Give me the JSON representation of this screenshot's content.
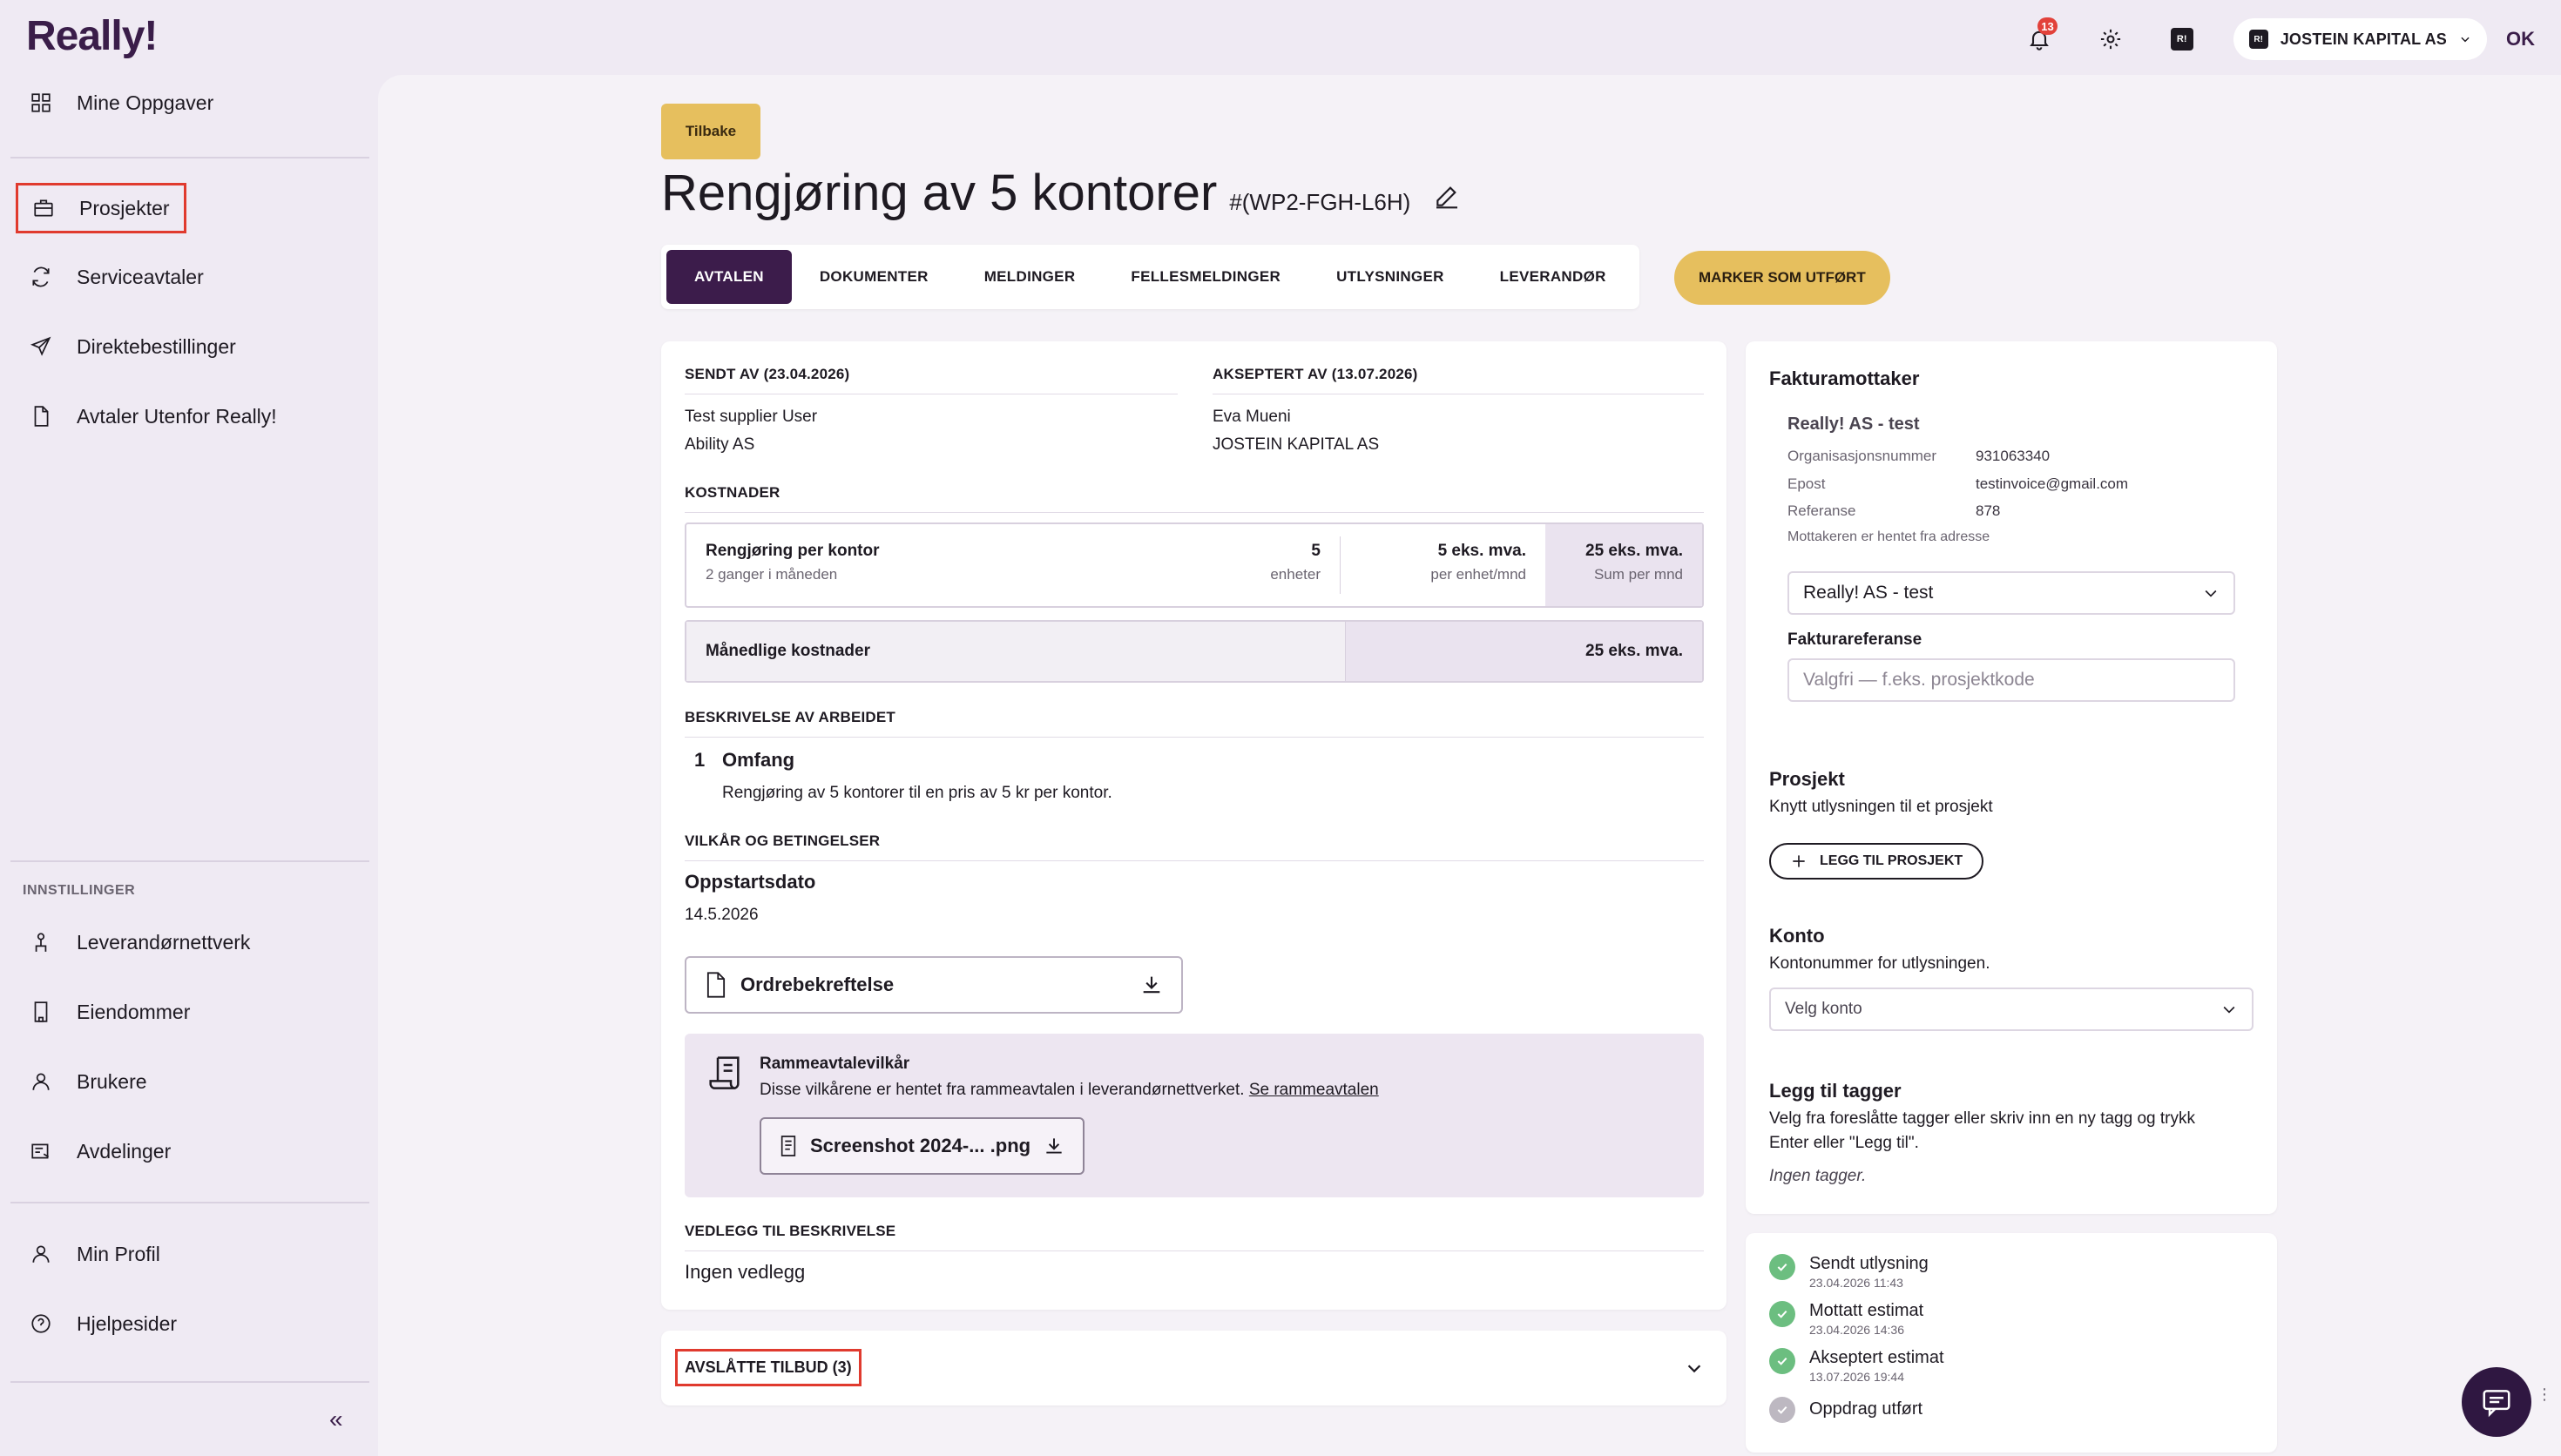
{
  "app": {
    "logo": "Really!"
  },
  "topbar": {
    "notifications_count": "13",
    "account_badge": "R!",
    "account_name": "JOSTEIN KAPITAL AS",
    "ok_label": "OK"
  },
  "sidebar": {
    "items": [
      {
        "label": "Mine Oppgaver",
        "icon": "grid-icon"
      },
      {
        "label": "Prosjekter",
        "icon": "briefcase-icon"
      },
      {
        "label": "Serviceavtaler",
        "icon": "refresh-icon"
      },
      {
        "label": "Direktebestillinger",
        "icon": "send-icon"
      },
      {
        "label": "Avtaler Utenfor Really!",
        "icon": "document-icon"
      }
    ],
    "settings_heading": "INNSTILLINGER",
    "settings_items": [
      {
        "label": "Leverandørnettverk",
        "icon": "network-icon"
      },
      {
        "label": "Eiendommer",
        "icon": "building-icon"
      },
      {
        "label": "Brukere",
        "icon": "user-icon"
      },
      {
        "label": "Avdelinger",
        "icon": "departments-icon"
      }
    ],
    "bottom_items": [
      {
        "label": "Min Profil",
        "icon": "user-icon"
      },
      {
        "label": "Hjelpesider",
        "icon": "help-icon"
      }
    ],
    "collapse_glyph": "«"
  },
  "page": {
    "back_label": "Tilbake",
    "title": "Rengjøring av 5 kontorer",
    "code": "#(WP2-FGH-L6H)",
    "tabs": [
      "AVTALEN",
      "DOKUMENTER",
      "MELDINGER",
      "FELLESMELDINGER",
      "UTLYSNINGER",
      "LEVERANDØR"
    ],
    "mark_done_label": "MARKER SOM UTFØRT"
  },
  "agreement": {
    "sent_label": "SENDT AV (23.04.2026)",
    "sent_name": "Test supplier User",
    "sent_company": "Ability AS",
    "accepted_label": "AKSEPTERT AV (13.07.2026)",
    "accepted_name": "Eva Mueni",
    "accepted_company": "JOSTEIN KAPITAL AS",
    "costs_label": "KOSTNADER",
    "cost_item": {
      "name": "Rengjøring per kontor",
      "frequency": "2 ganger i måneden",
      "qty": "5",
      "qty_unit": "enheter",
      "price": "5 eks. mva.",
      "price_unit": "per enhet/mnd",
      "sum": "25 eks. mva.",
      "sum_unit": "Sum per mnd"
    },
    "monthly_label": "Månedlige kostnader",
    "monthly_value": "25 eks. mva.",
    "description_label": "BESKRIVELSE AV ARBEIDET",
    "scope_number": "1",
    "scope_title": "Omfang",
    "scope_text": "Rengjøring av 5 kontorer til en pris av 5 kr per kontor.",
    "terms_label": "VILKÅR OG BETINGELSER",
    "start_label": "Oppstartsdato",
    "start_date": "14.5.2026",
    "order_confirmation": "Ordrebekreftelse",
    "frame_title": "Rammeavtalevilkår",
    "frame_desc": "Disse vilkårene er hentet fra rammeavtalen i leverandørnettverket.",
    "frame_link": "Se rammeavtalen",
    "frame_file": "Screenshot 2024-... .png",
    "attachments_label": "VEDLEGG TIL BESKRIVELSE",
    "attachments_value": "Ingen vedlegg",
    "rejected_label": "AVSLÅTTE TILBUD (3)"
  },
  "invoice": {
    "heading": "Fakturamottaker",
    "recipient_name": "Really! AS - test",
    "org_label": "Organisasjonsnummer",
    "org_value": "931063340",
    "email_label": "Epost",
    "email_value": "testinvoice@gmail.com",
    "ref_label": "Referanse",
    "ref_value": "878",
    "note": "Mottakeren er hentet fra adresse",
    "recipient_select": "Really! AS - test",
    "invoice_ref_label": "Fakturareferanse",
    "invoice_ref_placeholder": "Valgfri — f.eks. prosjektkode",
    "project_heading": "Prosjekt",
    "project_sub": "Knytt utlysningen til et prosjekt",
    "add_project_label": "LEGG TIL PROSJEKT",
    "account_heading": "Konto",
    "account_sub": "Kontonummer for utlysningen.",
    "account_select": "Velg konto",
    "tags_heading": "Legg til tagger",
    "tags_sub_1": "Velg fra foreslåtte tagger eller skriv inn en ny tagg og trykk",
    "tags_sub_2": "Enter eller \"Legg til\".",
    "tags_empty": "Ingen tagger."
  },
  "timeline": [
    {
      "title": "Sendt utlysning",
      "date": "23.04.2026 11:43",
      "done": true
    },
    {
      "title": "Mottatt estimat",
      "date": "23.04.2026 14:36",
      "done": true
    },
    {
      "title": "Akseptert estimat",
      "date": "13.07.2026 19:44",
      "done": true
    },
    {
      "title": "Oppdrag utført",
      "date": "",
      "done": false
    }
  ],
  "colors": {
    "primary": "#3c1c4b",
    "accent": "#e6bf5e",
    "success": "#6cbe80",
    "highlight": "#e03a2e"
  }
}
